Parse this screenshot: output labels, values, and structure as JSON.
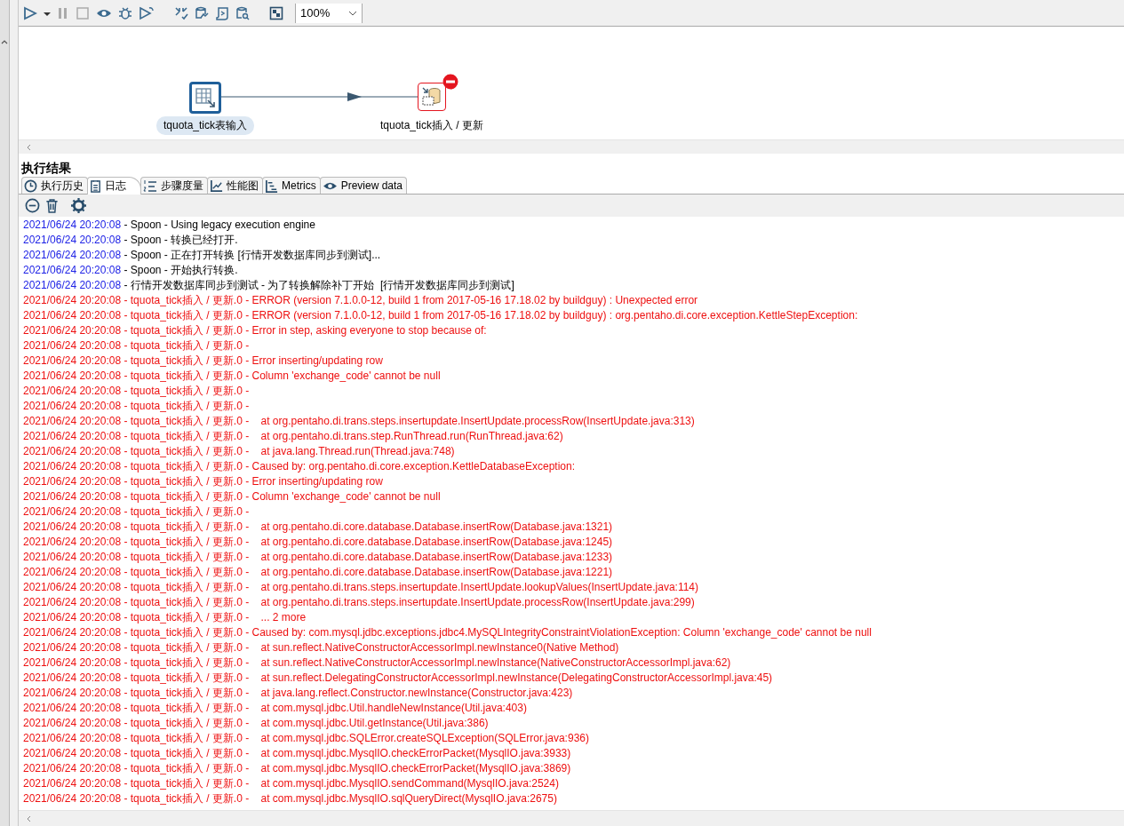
{
  "toolbar": {
    "zoom": "100%"
  },
  "canvas": {
    "steps": [
      {
        "kind": "input",
        "label": "tquota_tick表输入",
        "error": false
      },
      {
        "kind": "insert_update",
        "label": "tquota_tick插入 / 更新",
        "error": true
      }
    ]
  },
  "results": {
    "title": "执行结果",
    "tabs": [
      {
        "kind": "history",
        "label": "执行历史",
        "selected": false
      },
      {
        "kind": "log",
        "label": "日志",
        "selected": true
      },
      {
        "kind": "steps",
        "label": "步骤度量",
        "selected": false
      },
      {
        "kind": "performance",
        "label": "性能图",
        "selected": false
      },
      {
        "kind": "metrics",
        "label": "Metrics",
        "selected": false
      },
      {
        "kind": "preview",
        "label": "Preview data",
        "selected": false
      }
    ],
    "log": [
      {
        "kind": "info",
        "time": "2021/06/24 20:20:08",
        "text": " - Spoon - Using legacy execution engine"
      },
      {
        "kind": "info",
        "time": "2021/06/24 20:20:08",
        "text": " - Spoon - 转换已经打开."
      },
      {
        "kind": "info",
        "time": "2021/06/24 20:20:08",
        "text": " - Spoon - 正在打开转换 [行情开发数据库同步到测试]..."
      },
      {
        "kind": "info",
        "time": "2021/06/24 20:20:08",
        "text": " - Spoon - 开始执行转换."
      },
      {
        "kind": "info",
        "time": "2021/06/24 20:20:08",
        "text": " - 行情开发数据库同步到测试 - 为了转换解除补丁开始  [行情开发数据库同步到测试]"
      },
      {
        "kind": "error",
        "time": "2021/06/24 20:20:08",
        "text": " - tquota_tick插入 / 更新.0 - ERROR (version 7.1.0.0-12, build 1 from 2017-05-16 17.18.02 by buildguy) : Unexpected error"
      },
      {
        "kind": "error",
        "time": "2021/06/24 20:20:08",
        "text": " - tquota_tick插入 / 更新.0 - ERROR (version 7.1.0.0-12, build 1 from 2017-05-16 17.18.02 by buildguy) : org.pentaho.di.core.exception.KettleStepException:"
      },
      {
        "kind": "error",
        "time": "2021/06/24 20:20:08",
        "text": " - tquota_tick插入 / 更新.0 - Error in step, asking everyone to stop because of:"
      },
      {
        "kind": "error",
        "time": "2021/06/24 20:20:08",
        "text": " - tquota_tick插入 / 更新.0 -"
      },
      {
        "kind": "error",
        "time": "2021/06/24 20:20:08",
        "text": " - tquota_tick插入 / 更新.0 - Error inserting/updating row"
      },
      {
        "kind": "error",
        "time": "2021/06/24 20:20:08",
        "text": " - tquota_tick插入 / 更新.0 - Column 'exchange_code' cannot be null"
      },
      {
        "kind": "error",
        "time": "2021/06/24 20:20:08",
        "text": " - tquota_tick插入 / 更新.0 -"
      },
      {
        "kind": "error",
        "time": "2021/06/24 20:20:08",
        "text": " - tquota_tick插入 / 更新.0 -"
      },
      {
        "kind": "error",
        "time": "2021/06/24 20:20:08",
        "text": " - tquota_tick插入 / 更新.0 -    at org.pentaho.di.trans.steps.insertupdate.InsertUpdate.processRow(InsertUpdate.java:313)"
      },
      {
        "kind": "error",
        "time": "2021/06/24 20:20:08",
        "text": " - tquota_tick插入 / 更新.0 -    at org.pentaho.di.trans.step.RunThread.run(RunThread.java:62)"
      },
      {
        "kind": "error",
        "time": "2021/06/24 20:20:08",
        "text": " - tquota_tick插入 / 更新.0 -    at java.lang.Thread.run(Thread.java:748)"
      },
      {
        "kind": "error",
        "time": "2021/06/24 20:20:08",
        "text": " - tquota_tick插入 / 更新.0 - Caused by: org.pentaho.di.core.exception.KettleDatabaseException:"
      },
      {
        "kind": "error",
        "time": "2021/06/24 20:20:08",
        "text": " - tquota_tick插入 / 更新.0 - Error inserting/updating row"
      },
      {
        "kind": "error",
        "time": "2021/06/24 20:20:08",
        "text": " - tquota_tick插入 / 更新.0 - Column 'exchange_code' cannot be null"
      },
      {
        "kind": "error",
        "time": "2021/06/24 20:20:08",
        "text": " - tquota_tick插入 / 更新.0 -"
      },
      {
        "kind": "error",
        "time": "2021/06/24 20:20:08",
        "text": " - tquota_tick插入 / 更新.0 -    at org.pentaho.di.core.database.Database.insertRow(Database.java:1321)"
      },
      {
        "kind": "error",
        "time": "2021/06/24 20:20:08",
        "text": " - tquota_tick插入 / 更新.0 -    at org.pentaho.di.core.database.Database.insertRow(Database.java:1245)"
      },
      {
        "kind": "error",
        "time": "2021/06/24 20:20:08",
        "text": " - tquota_tick插入 / 更新.0 -    at org.pentaho.di.core.database.Database.insertRow(Database.java:1233)"
      },
      {
        "kind": "error",
        "time": "2021/06/24 20:20:08",
        "text": " - tquota_tick插入 / 更新.0 -    at org.pentaho.di.core.database.Database.insertRow(Database.java:1221)"
      },
      {
        "kind": "error",
        "time": "2021/06/24 20:20:08",
        "text": " - tquota_tick插入 / 更新.0 -    at org.pentaho.di.trans.steps.insertupdate.InsertUpdate.lookupValues(InsertUpdate.java:114)"
      },
      {
        "kind": "error",
        "time": "2021/06/24 20:20:08",
        "text": " - tquota_tick插入 / 更新.0 -    at org.pentaho.di.trans.steps.insertupdate.InsertUpdate.processRow(InsertUpdate.java:299)"
      },
      {
        "kind": "error",
        "time": "2021/06/24 20:20:08",
        "text": " - tquota_tick插入 / 更新.0 -    ... 2 more"
      },
      {
        "kind": "error",
        "time": "2021/06/24 20:20:08",
        "text": " - tquota_tick插入 / 更新.0 - Caused by: com.mysql.jdbc.exceptions.jdbc4.MySQLIntegrityConstraintViolationException: Column 'exchange_code' cannot be null"
      },
      {
        "kind": "error",
        "time": "2021/06/24 20:20:08",
        "text": " - tquota_tick插入 / 更新.0 -    at sun.reflect.NativeConstructorAccessorImpl.newInstance0(Native Method)"
      },
      {
        "kind": "error",
        "time": "2021/06/24 20:20:08",
        "text": " - tquota_tick插入 / 更新.0 -    at sun.reflect.NativeConstructorAccessorImpl.newInstance(NativeConstructorAccessorImpl.java:62)"
      },
      {
        "kind": "error",
        "time": "2021/06/24 20:20:08",
        "text": " - tquota_tick插入 / 更新.0 -    at sun.reflect.DelegatingConstructorAccessorImpl.newInstance(DelegatingConstructorAccessorImpl.java:45)"
      },
      {
        "kind": "error",
        "time": "2021/06/24 20:20:08",
        "text": " - tquota_tick插入 / 更新.0 -    at java.lang.reflect.Constructor.newInstance(Constructor.java:423)"
      },
      {
        "kind": "error",
        "time": "2021/06/24 20:20:08",
        "text": " - tquota_tick插入 / 更新.0 -    at com.mysql.jdbc.Util.handleNewInstance(Util.java:403)"
      },
      {
        "kind": "error",
        "time": "2021/06/24 20:20:08",
        "text": " - tquota_tick插入 / 更新.0 -    at com.mysql.jdbc.Util.getInstance(Util.java:386)"
      },
      {
        "kind": "error",
        "time": "2021/06/24 20:20:08",
        "text": " - tquota_tick插入 / 更新.0 -    at com.mysql.jdbc.SQLError.createSQLException(SQLError.java:936)"
      },
      {
        "kind": "error",
        "time": "2021/06/24 20:20:08",
        "text": " - tquota_tick插入 / 更新.0 -    at com.mysql.jdbc.MysqlIO.checkErrorPacket(MysqlIO.java:3933)"
      },
      {
        "kind": "error",
        "time": "2021/06/24 20:20:08",
        "text": " - tquota_tick插入 / 更新.0 -    at com.mysql.jdbc.MysqlIO.checkErrorPacket(MysqlIO.java:3869)"
      },
      {
        "kind": "error",
        "time": "2021/06/24 20:20:08",
        "text": " - tquota_tick插入 / 更新.0 -    at com.mysql.jdbc.MysqlIO.sendCommand(MysqlIO.java:2524)"
      },
      {
        "kind": "error",
        "time": "2021/06/24 20:20:08",
        "text": " - tquota_tick插入 / 更新.0 -    at com.mysql.jdbc.MysqlIO.sqlQueryDirect(MysqlIO.java:2675)"
      }
    ]
  }
}
